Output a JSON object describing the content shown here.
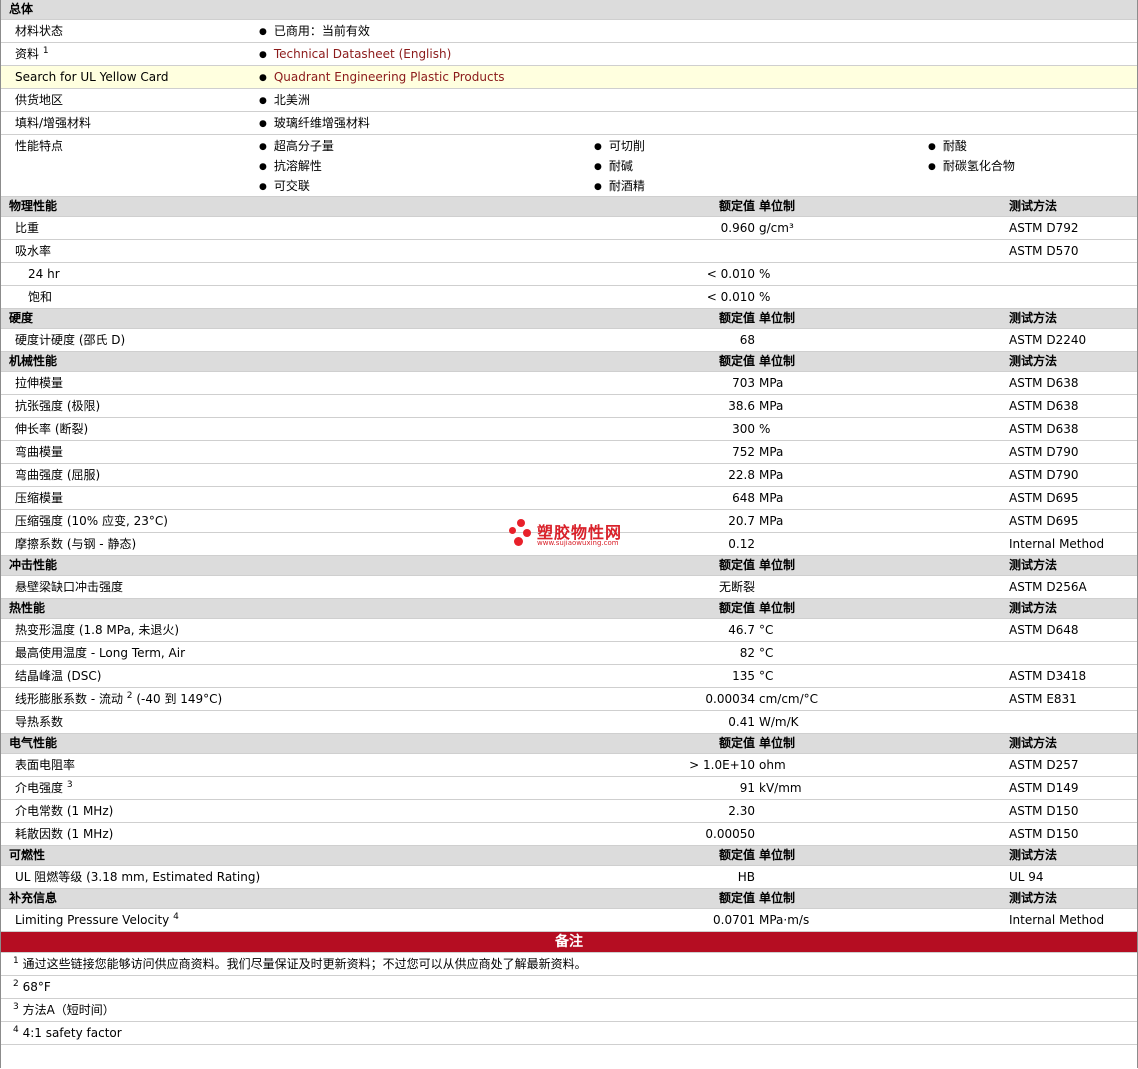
{
  "general": {
    "title": "总体",
    "status_label": "材料状态",
    "status_value": "已商用：当前有效",
    "docs_label": "资料",
    "docs_sup": "1",
    "docs_link": "Technical Datasheet (English)",
    "ul_label": "Search for UL Yellow Card",
    "ul_link": "Quadrant Engineering Plastic Products",
    "region_label": "供货地区",
    "region_value": "北美洲",
    "filler_label": "填料/增强材料",
    "filler_value": "玻璃纤维增强材料",
    "features_label": "性能特点",
    "features": [
      "超高分子量",
      "可切削",
      "耐酸",
      "抗溶解性",
      "耐碱",
      "耐碳氢化合物",
      "可交联",
      "耐酒精"
    ]
  },
  "col_headers": {
    "value": "额定值",
    "unit": "单位制",
    "method": "测试方法"
  },
  "physical": {
    "title": "物理性能",
    "specific_gravity": {
      "label": "比重",
      "value": "0.960",
      "unit": "g/cm³",
      "method": "ASTM D792"
    },
    "water_absorption": {
      "label": "吸水率",
      "method": "ASTM D570"
    },
    "wa_24hr": {
      "label": "24 hr",
      "value": "< 0.010",
      "unit": "%"
    },
    "wa_saturation": {
      "label": "饱和",
      "value": "< 0.010",
      "unit": "%"
    }
  },
  "hardness": {
    "title": "硬度",
    "shore_d": {
      "label": "硬度计硬度 (邵氏 D)",
      "value": "68",
      "method": "ASTM D2240"
    }
  },
  "mechanical": {
    "title": "机械性能",
    "tensile_modulus": {
      "label": "拉伸模量",
      "value": "703",
      "unit": "MPa",
      "method": "ASTM D638"
    },
    "tensile_strength": {
      "label": "抗张强度 (极限)",
      "value": "38.6",
      "unit": "MPa",
      "method": "ASTM D638"
    },
    "elongation": {
      "label": "伸长率 (断裂)",
      "value": "300",
      "unit": "%",
      "method": "ASTM D638"
    },
    "flexural_modulus": {
      "label": "弯曲模量",
      "value": "752",
      "unit": "MPa",
      "method": "ASTM D790"
    },
    "flexural_strength": {
      "label": "弯曲强度 (屈服)",
      "value": "22.8",
      "unit": "MPa",
      "method": "ASTM D790"
    },
    "compressive_modulus": {
      "label": "压缩模量",
      "value": "648",
      "unit": "MPa",
      "method": "ASTM D695"
    },
    "compressive_strength": {
      "label": "压缩强度 (10% 应变, 23°C)",
      "value": "20.7",
      "unit": "MPa",
      "method": "ASTM D695"
    },
    "friction": {
      "label": "摩擦系数 (与钢 - 静态)",
      "value": "0.12",
      "method": "Internal Method"
    }
  },
  "impact": {
    "title": "冲击性能",
    "izod": {
      "label": "悬壁梁缺口冲击强度",
      "value": "无断裂",
      "method": "ASTM D256A"
    }
  },
  "thermal": {
    "title": "热性能",
    "hdt": {
      "label": "热变形温度 (1.8 MPa, 未退火)",
      "value": "46.7",
      "unit": "°C",
      "method": "ASTM D648"
    },
    "max_service": {
      "label": "最高使用温度 - Long Term, Air",
      "value": "82",
      "unit": "°C"
    },
    "peak_cryst": {
      "label": "结晶峰温 (DSC)",
      "value": "135",
      "unit": "°C",
      "method": "ASTM D3418"
    },
    "clte_label": "线形膨胀系数 - 流动",
    "clte_sup": "2",
    "clte_suffix": "(-40 到 149°C)",
    "clte_value": "0.00034",
    "clte_unit": "cm/cm/°C",
    "clte_method": "ASTM E831",
    "conductivity": {
      "label": "导热系数",
      "value": "0.41",
      "unit": "W/m/K"
    }
  },
  "electrical": {
    "title": "电气性能",
    "surface_resistivity": {
      "label": "表面电阻率",
      "value": "> 1.0E+10",
      "unit": "ohm",
      "method": "ASTM D257"
    },
    "dielectric_strength_label": "介电强度",
    "dielectric_strength_sup": "3",
    "dielectric_strength_value": "91",
    "dielectric_strength_unit": "kV/mm",
    "dielectric_strength_method": "ASTM D149",
    "dielectric_constant": {
      "label": "介电常数 (1 MHz)",
      "value": "2.30",
      "method": "ASTM D150"
    },
    "dissipation": {
      "label": "耗散因数 (1 MHz)",
      "value": "0.00050",
      "method": "ASTM D150"
    }
  },
  "flammability": {
    "title": "可燃性",
    "ul": {
      "label": "UL 阻燃等级 (3.18 mm, Estimated Rating)",
      "value": "HB",
      "method": "UL 94"
    }
  },
  "supplemental": {
    "title": "补充信息",
    "lpv_label": "Limiting Pressure Velocity",
    "lpv_sup": "4",
    "lpv_value": "0.0701",
    "lpv_unit": "MPa·m/s",
    "lpv_method": "Internal Method"
  },
  "notes": {
    "title": "备注",
    "items": [
      {
        "num": "1",
        "text": "通过这些链接您能够访问供应商资料。我们尽量保证及时更新资料；不过您可以从供应商处了解最新资料。"
      },
      {
        "num": "2",
        "text": "68°F"
      },
      {
        "num": "3",
        "text": "方法A（短时间）"
      },
      {
        "num": "4",
        "text": "4:1 safety factor"
      }
    ]
  },
  "watermark": {
    "cn": "塑胶物性网",
    "url": "www.sujiaowuxing.com",
    "color": "#e8202a"
  }
}
